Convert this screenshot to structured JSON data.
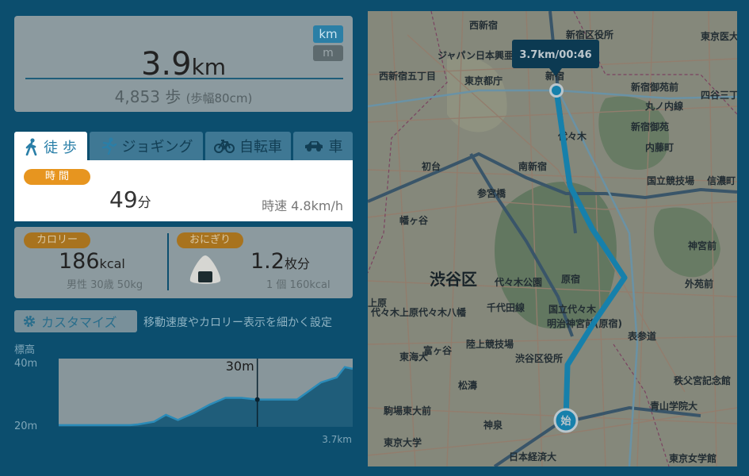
{
  "distance": {
    "value": "3.9",
    "unit": "km",
    "unit_toggle_km": "km",
    "unit_toggle_m": "m",
    "steps_value": "4,853 歩",
    "steps_note": "(歩幅80cm)"
  },
  "tabs": [
    {
      "label": "徒 歩",
      "icon": "walk-icon",
      "active": true
    },
    {
      "label": "ジョギング",
      "icon": "run-icon",
      "active": false
    },
    {
      "label": "自転車",
      "icon": "bicycle-icon",
      "active": false
    },
    {
      "label": "車",
      "icon": "car-icon",
      "active": false
    }
  ],
  "time": {
    "badge": "時 間",
    "value": "49",
    "unit": "分",
    "speed": "時速 4.8km/h"
  },
  "calorie": {
    "badge": "カロリー",
    "value": "186",
    "unit": "kcal",
    "sub": "男性 30歳 50kg"
  },
  "onigiri": {
    "badge": "おにぎり",
    "value": "1.2",
    "unit": "枚分",
    "sub": "1 個 160kcal"
  },
  "customize": {
    "button_label": "カスタマイズ",
    "description": "移動速度やカロリー表示を細かく設定"
  },
  "chart_data": {
    "type": "area",
    "title": "標高",
    "ylabels": [
      "40m",
      "20m"
    ],
    "xlabel_end": "3.7km",
    "ylim": [
      20,
      40
    ],
    "xlim": [
      0,
      3.7
    ],
    "x": [
      0,
      0.5,
      0.9,
      1.0,
      1.2,
      1.35,
      1.5,
      1.7,
      1.9,
      2.1,
      2.3,
      2.5,
      2.75,
      3.0,
      3.15,
      3.3,
      3.5,
      3.6,
      3.7
    ],
    "y": [
      20.5,
      20.5,
      20.5,
      20.7,
      21.5,
      23.5,
      22,
      24,
      26.5,
      28.5,
      28.5,
      28,
      28,
      28,
      30.5,
      33,
      34.5,
      37.5,
      37
    ],
    "cursor": {
      "x": 2.5,
      "label": "30m"
    },
    "colors": {
      "fill": "#1f5d7a",
      "line": "#2b8bb8",
      "cursor": "#0a2230"
    }
  },
  "map": {
    "district_label": "渋谷区",
    "tooltip": "3.7km/00:46",
    "start_marker": "始",
    "place_labels": [
      "西新宿",
      "東京医大",
      "新宿区役所",
      "ジャパン日本興亜",
      "西新宿五丁目",
      "東京都庁",
      "新宿",
      "新宿御苑前",
      "四谷三丁目",
      "新宿御苑",
      "丸ノ内線",
      "内藤町",
      "代々木",
      "南新宿",
      "初台",
      "参宮橋",
      "国立競技場",
      "信濃町",
      "幡ヶ谷",
      "代々木公園",
      "原宿",
      "代々木八幡",
      "千代田線",
      "明治神宮前(原宿)",
      "神宮前",
      "外苑前",
      "表参道",
      "渋谷区役所",
      "陸上競技場",
      "富ヶ谷",
      "松濤",
      "駒場東大前",
      "神泉",
      "東京大学",
      "青山学院大",
      "日本経済大",
      "東京女学館",
      "秩父宮記念館",
      "東海大",
      "国立代々木",
      "上原",
      "代々木上原"
    ],
    "colors": {
      "route": "#1b9fd1",
      "background": "#b4a98f"
    }
  }
}
